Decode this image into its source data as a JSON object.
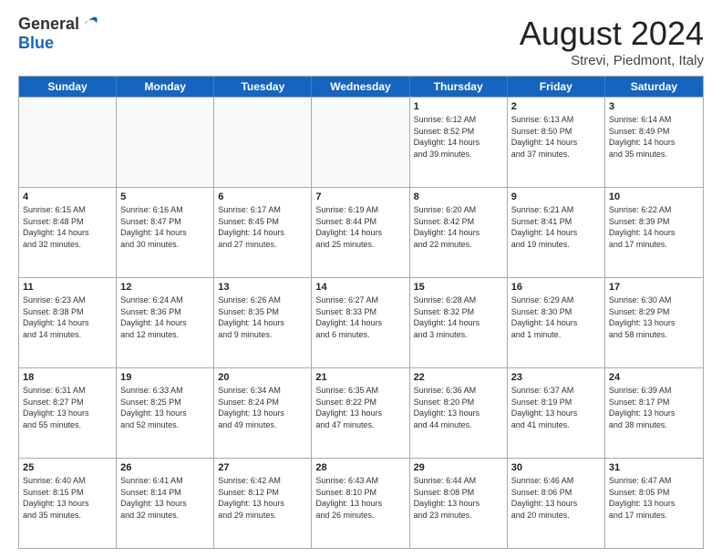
{
  "logo": {
    "general": "General",
    "blue": "Blue"
  },
  "title": "August 2024",
  "location": "Strevi, Piedmont, Italy",
  "days": [
    "Sunday",
    "Monday",
    "Tuesday",
    "Wednesday",
    "Thursday",
    "Friday",
    "Saturday"
  ],
  "weeks": [
    [
      {
        "day": "",
        "text": ""
      },
      {
        "day": "",
        "text": ""
      },
      {
        "day": "",
        "text": ""
      },
      {
        "day": "",
        "text": ""
      },
      {
        "day": "1",
        "text": "Sunrise: 6:12 AM\nSunset: 8:52 PM\nDaylight: 14 hours\nand 39 minutes."
      },
      {
        "day": "2",
        "text": "Sunrise: 6:13 AM\nSunset: 8:50 PM\nDaylight: 14 hours\nand 37 minutes."
      },
      {
        "day": "3",
        "text": "Sunrise: 6:14 AM\nSunset: 8:49 PM\nDaylight: 14 hours\nand 35 minutes."
      }
    ],
    [
      {
        "day": "4",
        "text": "Sunrise: 6:15 AM\nSunset: 8:48 PM\nDaylight: 14 hours\nand 32 minutes."
      },
      {
        "day": "5",
        "text": "Sunrise: 6:16 AM\nSunset: 8:47 PM\nDaylight: 14 hours\nand 30 minutes."
      },
      {
        "day": "6",
        "text": "Sunrise: 6:17 AM\nSunset: 8:45 PM\nDaylight: 14 hours\nand 27 minutes."
      },
      {
        "day": "7",
        "text": "Sunrise: 6:19 AM\nSunset: 8:44 PM\nDaylight: 14 hours\nand 25 minutes."
      },
      {
        "day": "8",
        "text": "Sunrise: 6:20 AM\nSunset: 8:42 PM\nDaylight: 14 hours\nand 22 minutes."
      },
      {
        "day": "9",
        "text": "Sunrise: 6:21 AM\nSunset: 8:41 PM\nDaylight: 14 hours\nand 19 minutes."
      },
      {
        "day": "10",
        "text": "Sunrise: 6:22 AM\nSunset: 8:39 PM\nDaylight: 14 hours\nand 17 minutes."
      }
    ],
    [
      {
        "day": "11",
        "text": "Sunrise: 6:23 AM\nSunset: 8:38 PM\nDaylight: 14 hours\nand 14 minutes."
      },
      {
        "day": "12",
        "text": "Sunrise: 6:24 AM\nSunset: 8:36 PM\nDaylight: 14 hours\nand 12 minutes."
      },
      {
        "day": "13",
        "text": "Sunrise: 6:26 AM\nSunset: 8:35 PM\nDaylight: 14 hours\nand 9 minutes."
      },
      {
        "day": "14",
        "text": "Sunrise: 6:27 AM\nSunset: 8:33 PM\nDaylight: 14 hours\nand 6 minutes."
      },
      {
        "day": "15",
        "text": "Sunrise: 6:28 AM\nSunset: 8:32 PM\nDaylight: 14 hours\nand 3 minutes."
      },
      {
        "day": "16",
        "text": "Sunrise: 6:29 AM\nSunset: 8:30 PM\nDaylight: 14 hours\nand 1 minute."
      },
      {
        "day": "17",
        "text": "Sunrise: 6:30 AM\nSunset: 8:29 PM\nDaylight: 13 hours\nand 58 minutes."
      }
    ],
    [
      {
        "day": "18",
        "text": "Sunrise: 6:31 AM\nSunset: 8:27 PM\nDaylight: 13 hours\nand 55 minutes."
      },
      {
        "day": "19",
        "text": "Sunrise: 6:33 AM\nSunset: 8:25 PM\nDaylight: 13 hours\nand 52 minutes."
      },
      {
        "day": "20",
        "text": "Sunrise: 6:34 AM\nSunset: 8:24 PM\nDaylight: 13 hours\nand 49 minutes."
      },
      {
        "day": "21",
        "text": "Sunrise: 6:35 AM\nSunset: 8:22 PM\nDaylight: 13 hours\nand 47 minutes."
      },
      {
        "day": "22",
        "text": "Sunrise: 6:36 AM\nSunset: 8:20 PM\nDaylight: 13 hours\nand 44 minutes."
      },
      {
        "day": "23",
        "text": "Sunrise: 6:37 AM\nSunset: 8:19 PM\nDaylight: 13 hours\nand 41 minutes."
      },
      {
        "day": "24",
        "text": "Sunrise: 6:39 AM\nSunset: 8:17 PM\nDaylight: 13 hours\nand 38 minutes."
      }
    ],
    [
      {
        "day": "25",
        "text": "Sunrise: 6:40 AM\nSunset: 8:15 PM\nDaylight: 13 hours\nand 35 minutes."
      },
      {
        "day": "26",
        "text": "Sunrise: 6:41 AM\nSunset: 8:14 PM\nDaylight: 13 hours\nand 32 minutes."
      },
      {
        "day": "27",
        "text": "Sunrise: 6:42 AM\nSunset: 8:12 PM\nDaylight: 13 hours\nand 29 minutes."
      },
      {
        "day": "28",
        "text": "Sunrise: 6:43 AM\nSunset: 8:10 PM\nDaylight: 13 hours\nand 26 minutes."
      },
      {
        "day": "29",
        "text": "Sunrise: 6:44 AM\nSunset: 8:08 PM\nDaylight: 13 hours\nand 23 minutes."
      },
      {
        "day": "30",
        "text": "Sunrise: 6:46 AM\nSunset: 8:06 PM\nDaylight: 13 hours\nand 20 minutes."
      },
      {
        "day": "31",
        "text": "Sunrise: 6:47 AM\nSunset: 8:05 PM\nDaylight: 13 hours\nand 17 minutes."
      }
    ]
  ]
}
